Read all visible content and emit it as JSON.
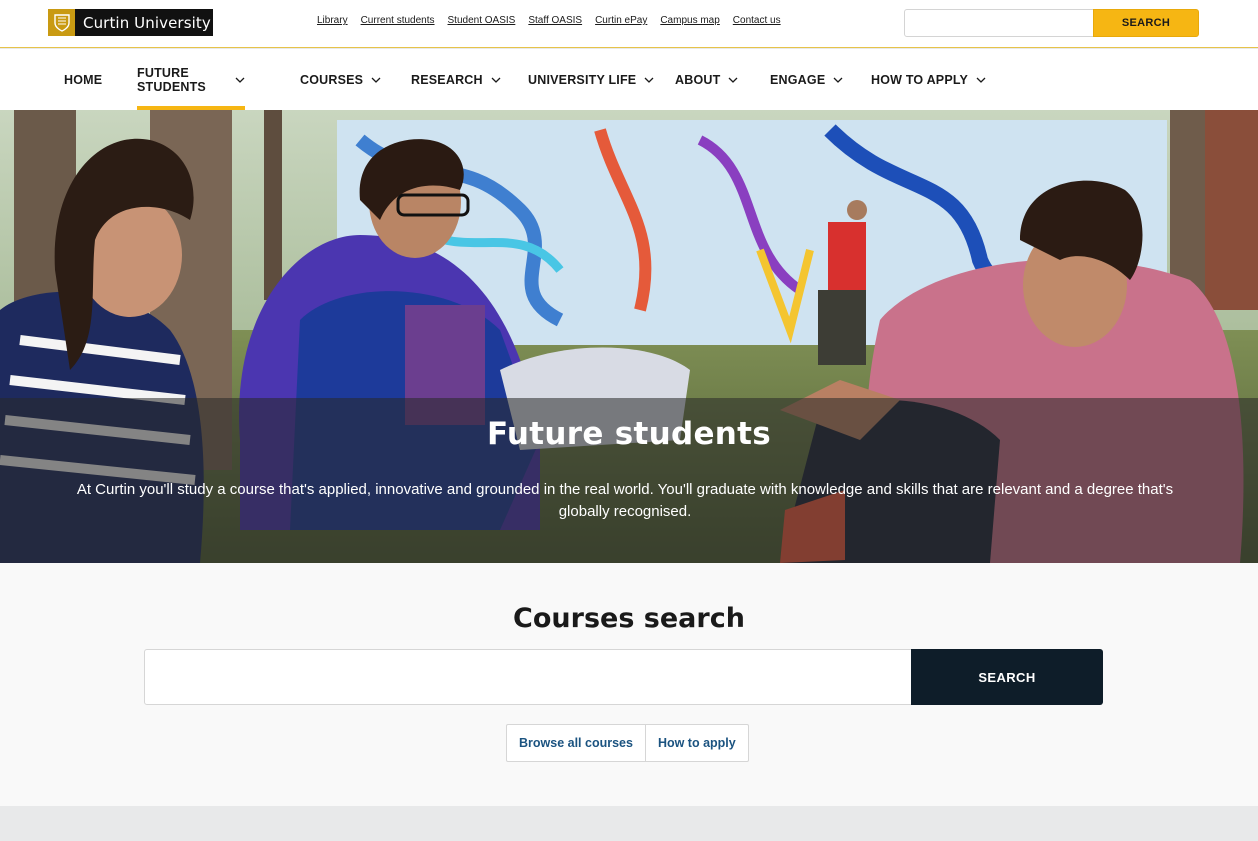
{
  "brand": {
    "name": "Curtin University",
    "logo_color": "#c99a12"
  },
  "utility_links": [
    "Library",
    "Current students",
    "Student OASIS",
    "Staff OASIS",
    "Curtin ePay",
    "Campus map",
    "Contact us"
  ],
  "top_search": {
    "placeholder": "",
    "button_label": "SEARCH",
    "accent": "#f6b613"
  },
  "nav": {
    "items": [
      {
        "label": "HOME",
        "has_dropdown": false
      },
      {
        "label": "FUTURE STUDENTS",
        "has_dropdown": true,
        "active": true
      },
      {
        "label": "COURSES",
        "has_dropdown": true
      },
      {
        "label": "RESEARCH",
        "has_dropdown": true
      },
      {
        "label": "UNIVERSITY LIFE",
        "has_dropdown": true
      },
      {
        "label": "ABOUT",
        "has_dropdown": true
      },
      {
        "label": "ENGAGE",
        "has_dropdown": true
      },
      {
        "label": "HOW TO APPLY",
        "has_dropdown": true
      }
    ]
  },
  "hero": {
    "title": "Future students",
    "text": "At Curtin you'll study a course that's applied, innovative and grounded in the real world. You'll graduate with knowledge and skills that are relevant and a degree that's globally recognised."
  },
  "courses_search": {
    "title": "Courses search",
    "placeholder": "",
    "button_label": "SEARCH",
    "button_color": "#0e1d29",
    "links": [
      "Browse all courses",
      "How to apply"
    ]
  }
}
